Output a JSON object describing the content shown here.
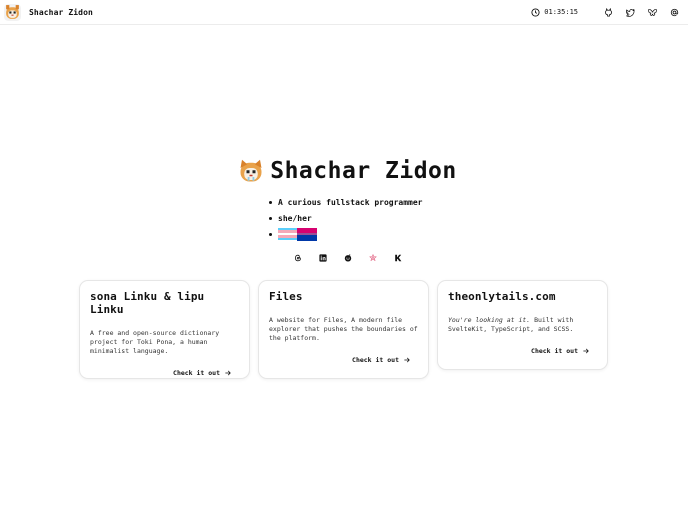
{
  "header": {
    "brand_name": "Shachar Zidon",
    "time": "01:35:15",
    "icons": [
      "github-icon",
      "twitter-icon",
      "bluesky-icon",
      "email-at-icon"
    ]
  },
  "hero": {
    "title": "Shachar Zidon",
    "facts": [
      "A curious fullstack programmer",
      "she/her"
    ],
    "flags": [
      "transgender-flag",
      "bisexual-flag"
    ],
    "socials": [
      "threads-icon",
      "linkedin-icon",
      "reddit-icon",
      "misskey-icon",
      "kofi-icon"
    ]
  },
  "projects": [
    {
      "title": "sona Linku & lipu Linku",
      "description": "A free and open-source dictionary project for Toki Pona, a human minimalist language.",
      "link": "Check it out"
    },
    {
      "title": "Files",
      "description": "A website for Files, A modern file explorer that pushes the boundaries of the platform.",
      "link": "Check it out"
    },
    {
      "title": "theonlytails.com",
      "description_em": "You're looking at it.",
      "description_rest": " Built with SvelteKit, TypeScript, and SCSS.",
      "link": "Check it out"
    }
  ],
  "colors": {
    "trans_blue": "#5BCEFA",
    "trans_pink": "#F5A9B8",
    "bi_pink": "#D60270",
    "bi_purple": "#9B4F96",
    "bi_blue": "#0038A8"
  }
}
